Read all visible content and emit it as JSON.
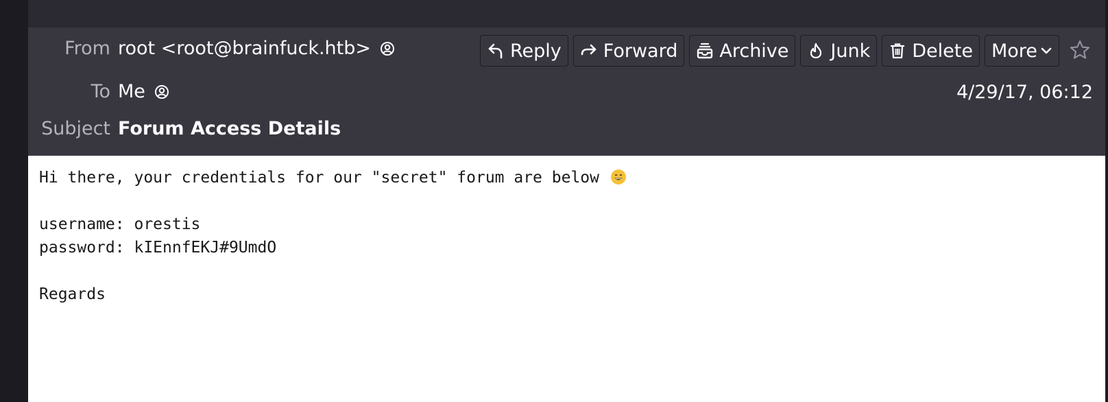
{
  "header": {
    "from_label": "From",
    "from_value": "root <root@brainfuck.htb>",
    "to_label": "To",
    "to_value": "Me",
    "subject_label": "Subject",
    "subject_value": "Forum Access Details",
    "date": "4/29/17, 06:12"
  },
  "toolbar": {
    "reply": "Reply",
    "forward": "Forward",
    "archive": "Archive",
    "junk": "Junk",
    "delete": "Delete",
    "more": "More"
  },
  "message": {
    "greeting": "Hi there, your credentials for our \"secret\" forum are below",
    "username_line": "username: orestis",
    "password_line": "password: kIEnnfEKJ#9UmdO",
    "signoff": "Regards"
  },
  "colors": {
    "header_bg": "#38373f",
    "topbar_bg": "#2b2a33",
    "text_light": "#fbfbfe",
    "label_muted": "#b4b3b9",
    "body_bg": "#ffffff",
    "emoji_yellow": "#f5c13b"
  },
  "icons": {
    "from_contact": "contact-icon",
    "to_contact": "contact-icon",
    "reply": "reply-icon",
    "forward": "forward-icon",
    "archive": "archive-icon",
    "junk": "flame-icon",
    "delete": "trash-icon",
    "more": "chevron-down-icon",
    "star": "star-icon",
    "emoji": "grinning-face-icon"
  }
}
